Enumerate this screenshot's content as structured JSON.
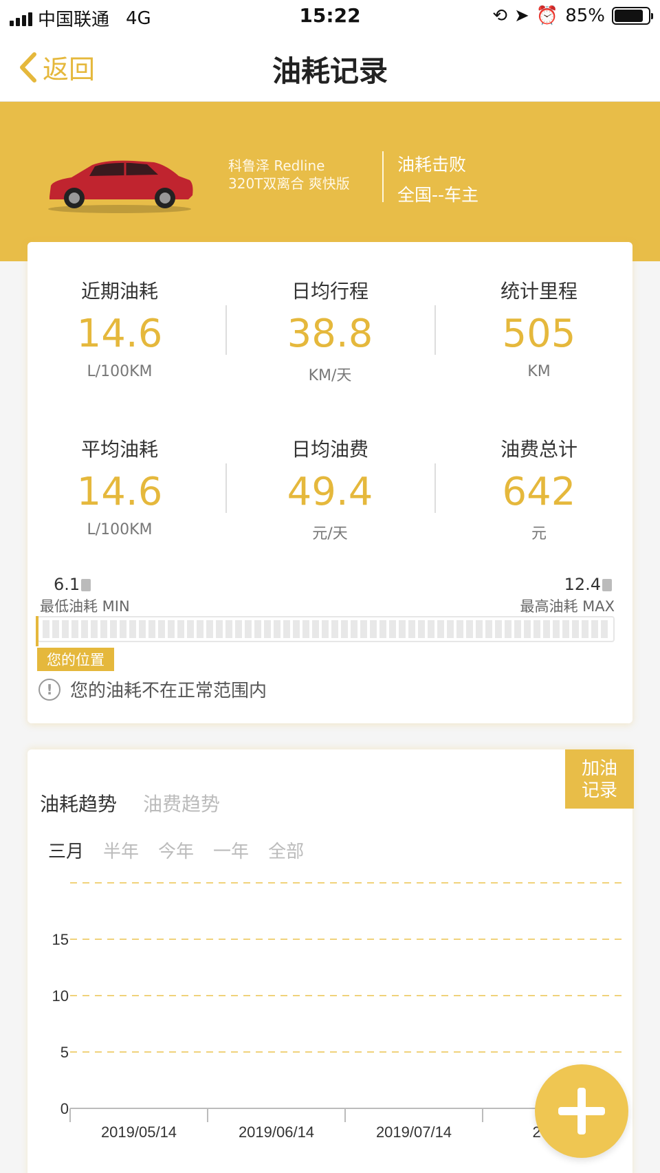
{
  "status_bar": {
    "carrier": "中国联通",
    "network": "4G",
    "time": "15:22",
    "battery": "85%",
    "battery_level": 0.85
  },
  "nav": {
    "back_label": "返回",
    "title": "油耗记录"
  },
  "vehicle": {
    "model_line1": "科鲁泽 Redline",
    "model_line2": "320T双离合 爽快版",
    "car_color": "#c0242f"
  },
  "rank": {
    "line1": "油耗击败",
    "line2": "全国--车主"
  },
  "stats": [
    {
      "label": "近期油耗",
      "value": "14.6",
      "unit": "L/100KM"
    },
    {
      "label": "日均行程",
      "value": "38.8",
      "unit": "KM/天"
    },
    {
      "label": "统计里程",
      "value": "505",
      "unit": "KM"
    },
    {
      "label": "平均油耗",
      "value": "14.6",
      "unit": "L/100KM"
    },
    {
      "label": "日均油费",
      "value": "49.4",
      "unit": "元/天"
    },
    {
      "label": "油费总计",
      "value": "642",
      "unit": "元"
    }
  ],
  "range": {
    "min_value": "6.1",
    "min_label": "最低油耗 MIN",
    "max_value": "12.4",
    "max_label": "最高油耗 MAX",
    "position_label": "您的位置",
    "warning": "您的油耗不在正常范围内"
  },
  "fuel_record_button": {
    "line1": "加油",
    "line2": "记录"
  },
  "chart_tabs": [
    {
      "label": "油耗趋势",
      "active": true
    },
    {
      "label": "油费趋势",
      "active": false
    }
  ],
  "time_ranges": [
    {
      "label": "三月",
      "active": true
    },
    {
      "label": "半年",
      "active": false
    },
    {
      "label": "今年",
      "active": false
    },
    {
      "label": "一年",
      "active": false
    },
    {
      "label": "全部",
      "active": false
    }
  ],
  "colors": {
    "accent": "#e8bd48",
    "accent_text": "#e5b83c",
    "grid": "#f0d27a"
  },
  "chart_data": {
    "type": "line",
    "title": "",
    "xlabel": "",
    "ylabel": "",
    "y_ticks": [
      0,
      5,
      10,
      15
    ],
    "ylim": [
      0,
      20
    ],
    "x_ticks": [
      "2019/05/14",
      "2019/06/14",
      "2019/07/14",
      "2019/"
    ],
    "series": [],
    "grid": true
  }
}
